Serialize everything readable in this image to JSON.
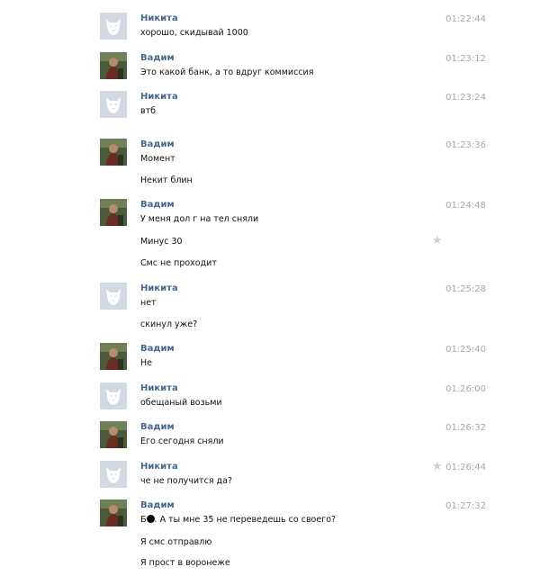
{
  "messages": [
    {
      "author": "Никита",
      "time": "01:22:44",
      "lines": [
        "хорошо, скидывай 1000"
      ]
    },
    {
      "author": "Вадим",
      "time": "01:23:12",
      "lines": [
        "Это какой банк, а то вдруг коммиссия"
      ]
    },
    {
      "author": "Никита",
      "time": "01:23:24",
      "lines": [
        "втб"
      ]
    },
    {
      "author": "Вадим",
      "time": "01:23:36",
      "lines": [
        "Момент",
        "Некит блин"
      ]
    },
    {
      "author": "Вадим",
      "time": "01:24:48",
      "lines": [
        "У меня дол г на тел сняли",
        "Минус 30",
        "Смс не проходит"
      ]
    },
    {
      "author": "Никита",
      "time": "01:25:28",
      "lines": [
        "нет",
        "скинул уже?"
      ]
    },
    {
      "author": "Вадим",
      "time": "01:25:40",
      "lines": [
        "Не"
      ]
    },
    {
      "author": "Никита",
      "time": "01:26:00",
      "lines": [
        "обещаный возьми"
      ]
    },
    {
      "author": "Вадим",
      "time": "01:26:32",
      "lines": [
        "Его сегодня сняли"
      ]
    },
    {
      "author": "Никита",
      "time": "01:26:44",
      "lines": [
        "че не получится да?"
      ]
    },
    {
      "author": "Вадим",
      "time": "01:27:32",
      "lines": [
        "Б",
        ". А ты мне 35 не переведешь со своего?",
        "Я смс отправлю",
        "Я прост в воронеже"
      ]
    }
  ],
  "colors": {
    "author": "#45688e",
    "time": "#a7a7a7",
    "star": "#cfcfcf"
  },
  "icons": {
    "nikita_avatar": "dog-avatar-icon",
    "vadim_avatar": "photo-avatar-icon",
    "favorite": "star-icon"
  }
}
